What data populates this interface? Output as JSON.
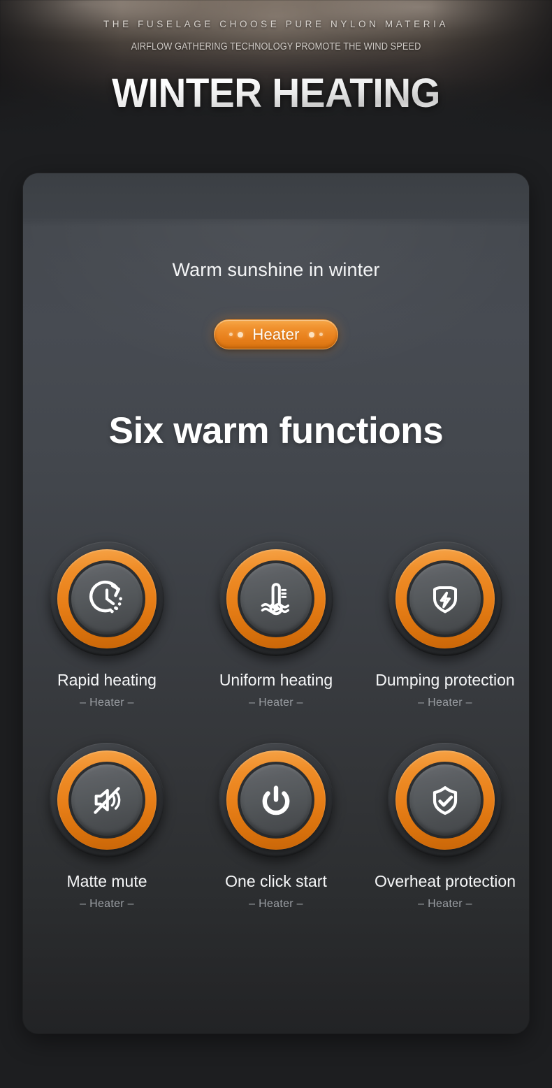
{
  "hero": {
    "kicker_top": "THE FUSELAGE CHOOSE PURE NYLON MATERIA",
    "kicker_sub": "AIRFLOW GATHERING TECHNOLOGY PROMOTE THE WIND SPEED",
    "title": "WINTER HEATING"
  },
  "card": {
    "subtitle": "Warm sunshine in winter",
    "badge": {
      "label": "Heater"
    },
    "headline": "Six warm functions"
  },
  "features": [
    {
      "icon": "clock-timer-icon",
      "label": "Rapid heating",
      "sub": "– Heater –"
    },
    {
      "icon": "thermometer-waves-icon",
      "label": "Uniform heating",
      "sub": "– Heater –"
    },
    {
      "icon": "shield-bolt-icon",
      "label": "Dumping protection",
      "sub": "– Heater –"
    },
    {
      "icon": "speaker-mute-icon",
      "label": "Matte mute",
      "sub": "– Heater –"
    },
    {
      "icon": "power-button-icon",
      "label": "One click start",
      "sub": "– Heater –"
    },
    {
      "icon": "shield-check-icon",
      "label": "Overheat protection",
      "sub": "– Heater –"
    }
  ],
  "colors": {
    "accent_orange": "#ed8220",
    "accent_orange_light": "#f6a347",
    "page_background": "#1d1e20",
    "card_top": "#3e4248",
    "card_bottom": "#222325",
    "text_primary": "#f6f7f8",
    "text_muted": "#9a9ea3"
  }
}
